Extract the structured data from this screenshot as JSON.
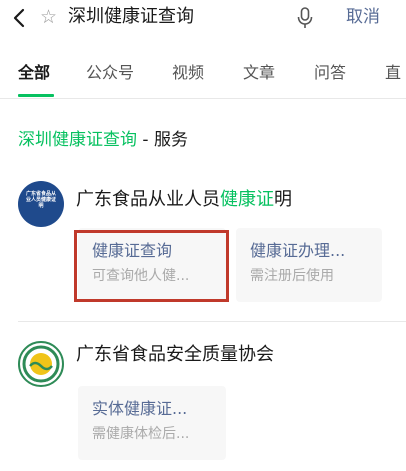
{
  "search": {
    "query": "深圳健康证查询",
    "cancel_label": "取消"
  },
  "tabs": [
    {
      "label": "全部",
      "active": true
    },
    {
      "label": "公众号",
      "active": false
    },
    {
      "label": "视频",
      "active": false
    },
    {
      "label": "文章",
      "active": false
    },
    {
      "label": "问答",
      "active": false
    },
    {
      "label": "直",
      "active": false
    }
  ],
  "section": {
    "highlight": "深圳健康证查询",
    "suffix": " - 服务"
  },
  "accounts": [
    {
      "name_prefix": "广东食品从业人员",
      "name_highlight": "健康证",
      "name_suffix": "明",
      "avatar_text": "广东省食品从业人员健康证明",
      "services": [
        {
          "title": "健康证查询",
          "subtitle": "可查询他人健..."
        },
        {
          "title": "健康证办理...",
          "subtitle": "需注册后使用"
        }
      ]
    },
    {
      "name": "广东省食品安全质量协会",
      "services": [
        {
          "title": "实体健康证...",
          "subtitle": "需健康体检后..."
        }
      ]
    }
  ],
  "colors": {
    "accent_green": "#07c160",
    "link_blue": "#576b95",
    "annotation_red": "#c0392b"
  },
  "icons": [
    "back-arrow-icon",
    "star-icon",
    "microphone-icon"
  ]
}
